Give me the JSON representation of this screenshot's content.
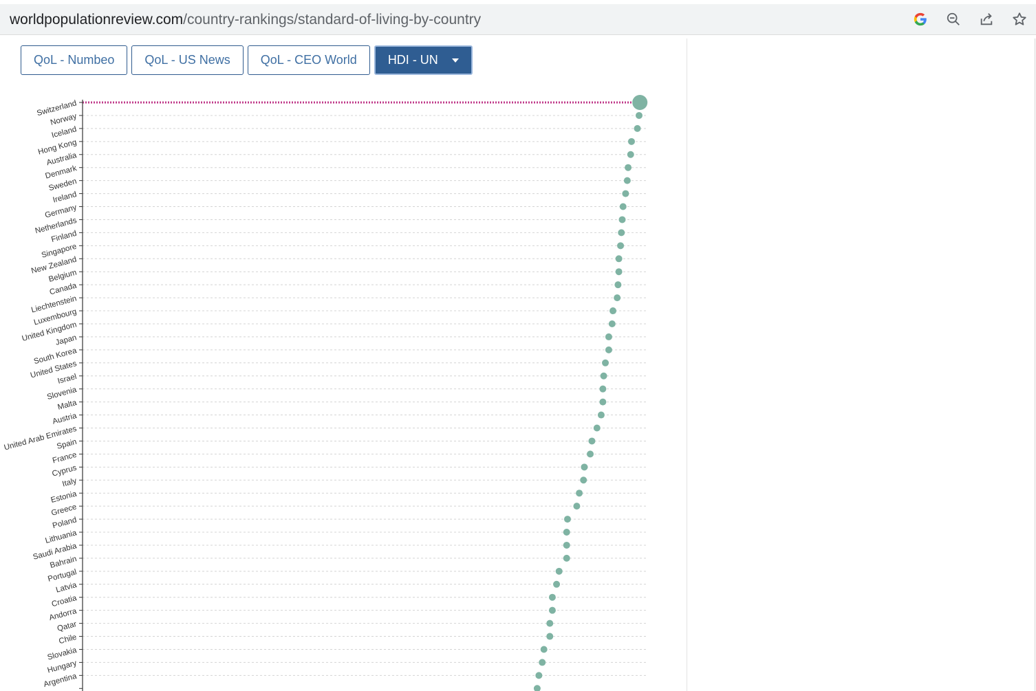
{
  "browser": {
    "url_host": "worldpopulationreview.com",
    "url_path": "/country-rankings/standard-of-living-by-country",
    "icons": [
      "google-icon",
      "zoom-out-icon",
      "share-icon",
      "star-icon"
    ]
  },
  "tabs": [
    {
      "label": "QoL - Numbeo",
      "active": false
    },
    {
      "label": "QoL - US News",
      "active": false
    },
    {
      "label": "QoL - CEO World",
      "active": false
    },
    {
      "label": "HDI - UN",
      "active": true
    }
  ],
  "colors": {
    "dot": "#7fb3a3",
    "highlight_line": "#c0398a",
    "tab_active": "#2f5d92"
  },
  "chart_data": {
    "type": "scatter",
    "orientation": "horizontal",
    "categories": [
      "Switzerland",
      "Norway",
      "Iceland",
      "Hong Kong",
      "Australia",
      "Denmark",
      "Sweden",
      "Ireland",
      "Germany",
      "Netherlands",
      "Finland",
      "Singapore",
      "New Zealand",
      "Belgium",
      "Canada",
      "Liechtenstein",
      "Luxembourg",
      "United Kingdom",
      "Japan",
      "South Korea",
      "United States",
      "Israel",
      "Slovenia",
      "Malta",
      "Austria",
      "United Arab Emirates",
      "Spain",
      "France",
      "Cyprus",
      "Italy",
      "Estonia",
      "Greece",
      "Poland",
      "Lithuania",
      "Saudi Arabia",
      "Bahrain",
      "Portugal",
      "Latvia",
      "Croatia",
      "Andorra",
      "Qatar",
      "Chile",
      "Slovakia",
      "Hungary",
      "Argentina"
    ],
    "values": [
      0.962,
      0.961,
      0.959,
      0.952,
      0.951,
      0.948,
      0.947,
      0.945,
      0.942,
      0.941,
      0.94,
      0.939,
      0.937,
      0.937,
      0.936,
      0.935,
      0.93,
      0.929,
      0.925,
      0.925,
      0.921,
      0.919,
      0.918,
      0.918,
      0.916,
      0.911,
      0.905,
      0.903,
      0.896,
      0.895,
      0.89,
      0.887,
      0.876,
      0.875,
      0.875,
      0.875,
      0.866,
      0.863,
      0.858,
      0.858,
      0.855,
      0.855,
      0.848,
      0.846,
      0.842
    ],
    "xlim": [
      0.3,
      0.97
    ],
    "grid": true,
    "highlight": "Switzerland"
  }
}
